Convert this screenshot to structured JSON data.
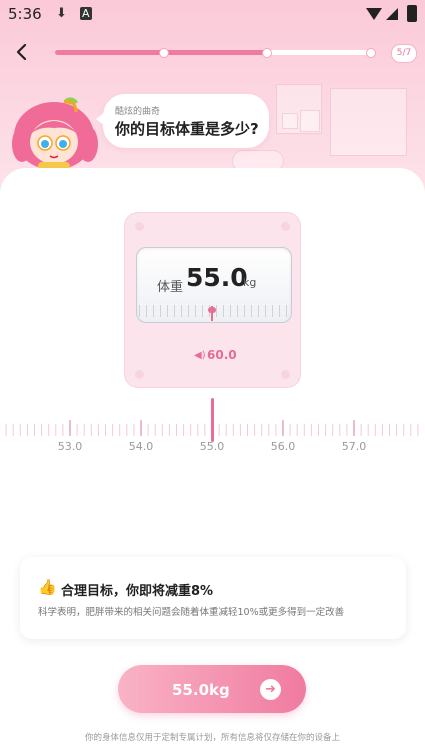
{
  "status_bar": {
    "time": "5:36"
  },
  "header": {
    "step_indicator": "5/7",
    "progress": 0.67
  },
  "bubble": {
    "name": "酷炫的曲奇",
    "question": "你的目标体重是多少?"
  },
  "scale": {
    "label": "体重",
    "value": "55.0",
    "unit": "kg",
    "previous": "60.0"
  },
  "ruler": {
    "labels": [
      "53.0",
      "54.0",
      "55.0",
      "56.0",
      "57.0"
    ],
    "selected": "55.0"
  },
  "info": {
    "icon": "thumbs-up",
    "title": "合理目标，你即将减重8%",
    "description": "科学表明，肥胖带来的相关问题会随着体重减轻10%或更多得到一定改善"
  },
  "cta": {
    "label": "55.0kg"
  },
  "footer": {
    "text": "你的身体信息仅用于定制专属计划，所有信息将仅存储在你的设备上"
  },
  "colors": {
    "accent": "#f07ba0",
    "header_bg": "#fcd6e1",
    "scale_bg": "#fce4ec"
  }
}
